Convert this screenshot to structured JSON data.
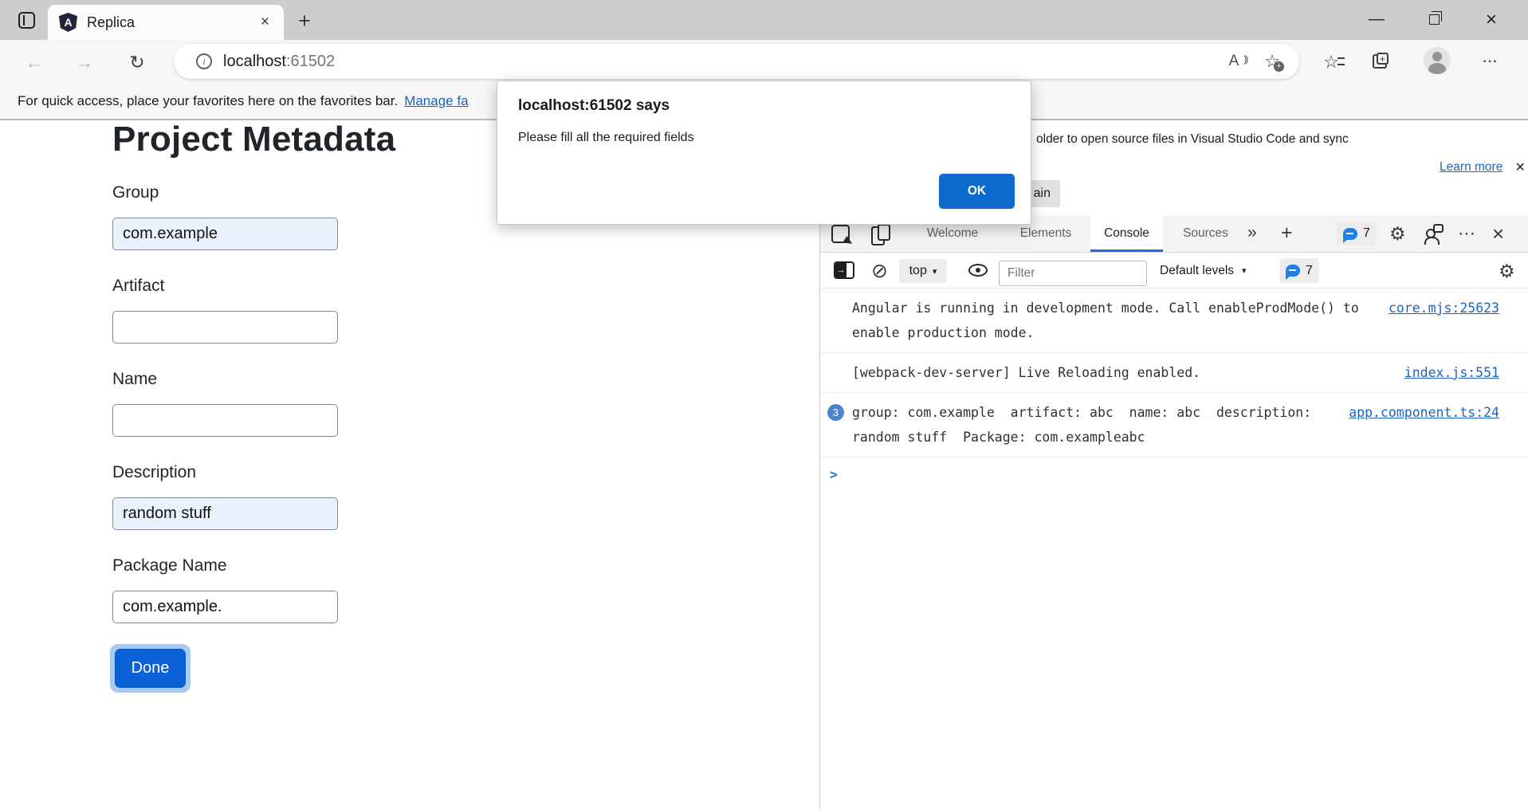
{
  "window": {
    "tab_title": "Replica",
    "url_host": "localhost",
    "url_port": ":61502"
  },
  "favorites_bar": {
    "message": "For quick access, place your favorites here on the favorites bar.",
    "link_label": "Manage fa"
  },
  "page": {
    "title": "Project Metadata",
    "fields": [
      {
        "label": "Group",
        "value": "com.example",
        "filled": true
      },
      {
        "label": "Artifact",
        "value": "",
        "filled": false
      },
      {
        "label": "Name",
        "value": "",
        "filled": false
      },
      {
        "label": "Description",
        "value": "random stuff",
        "filled": true
      },
      {
        "label": "Package Name",
        "value": "com.example.",
        "filled": false
      }
    ],
    "done_label": "Done"
  },
  "dialog": {
    "title": "localhost:61502 says",
    "message": "Please fill all the required fields",
    "ok_label": "OK",
    "clipped_button_label": "ain"
  },
  "devtools": {
    "notification": {
      "text": "older to open source files in Visual Studio Code and sync",
      "link_label": "Learn more"
    },
    "tabs": [
      {
        "label": "Welcome"
      },
      {
        "label": "Elements"
      },
      {
        "label": "Console"
      },
      {
        "label": "Sources"
      }
    ],
    "active_tab": "Console",
    "issues_count": "7",
    "toolbar": {
      "context": "top",
      "filter_placeholder": "Filter",
      "levels_label": "Default levels",
      "issues_count": "7"
    },
    "console": {
      "messages": [
        {
          "badge": "",
          "text": "Angular is running in development mode. Call enableProdMode() to enable production mode.",
          "source": "core.mjs:25623"
        },
        {
          "badge": "",
          "text": "[webpack-dev-server] Live Reloading enabled.",
          "source": "index.js:551"
        },
        {
          "badge": "3",
          "text": "group: com.example  artifact: abc  name: abc  description: random stuff  Package: com.exampleabc",
          "source": "app.component.ts:24"
        }
      ],
      "prompt": ">"
    }
  },
  "icons": {
    "back": "←",
    "forward": "→",
    "refresh": "↻",
    "close": "×",
    "plus": "+",
    "star": "☆",
    "read_aloud": "A",
    "minimize": "—",
    "overflow": "···",
    "clear": "⊘",
    "gear": "⚙",
    "more_tabs": "»",
    "dropdown": "▾",
    "dots": "⋯"
  },
  "colors": {
    "accent_blue": "#0b62d6",
    "dialog_button_blue": "#0d6bcd",
    "devtools_tab_underline": "#1a6fd4",
    "console_link_blue": "#1962c6",
    "issues_bubble_blue": "#2080e8",
    "log_count_badge_blue": "#4a84ca",
    "filled_input_bg": "#e9f1fd",
    "titlebar_gray": "#cdcdcd"
  }
}
